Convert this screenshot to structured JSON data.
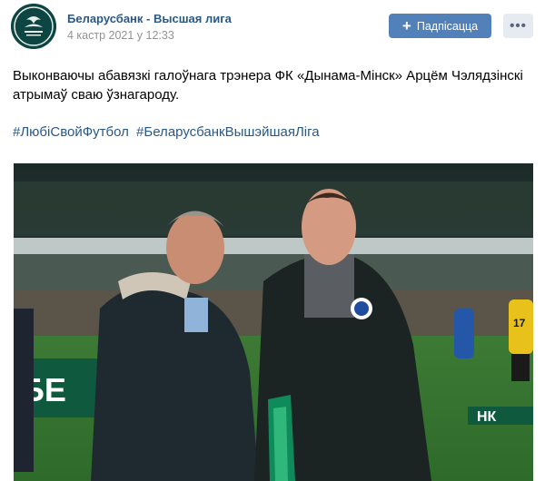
{
  "header": {
    "author": "Беларусбанк - Высшая лига",
    "date": "4 кастр 2021 у 12:33",
    "subscribe_label": "Падпісацца",
    "more_label": "•••"
  },
  "post": {
    "text": "Выконваючы абавязкі галоўнага трэнера ФК «Дынама-Мінск» Арцём Чэлядзінскі атрымаў сваю ўзнагароду.",
    "hashtags": [
      "#ЛюбіСвойФутбол",
      "#БеларусбанкВышэйшаяЛіга"
    ]
  },
  "photo": {
    "banner_text": "БЕ",
    "banner_text_right": "НК",
    "player_number": "17"
  },
  "colors": {
    "link": "#2a5885",
    "button": "#5181b8",
    "button_secondary": "#e5ebf1",
    "muted": "#939393"
  }
}
